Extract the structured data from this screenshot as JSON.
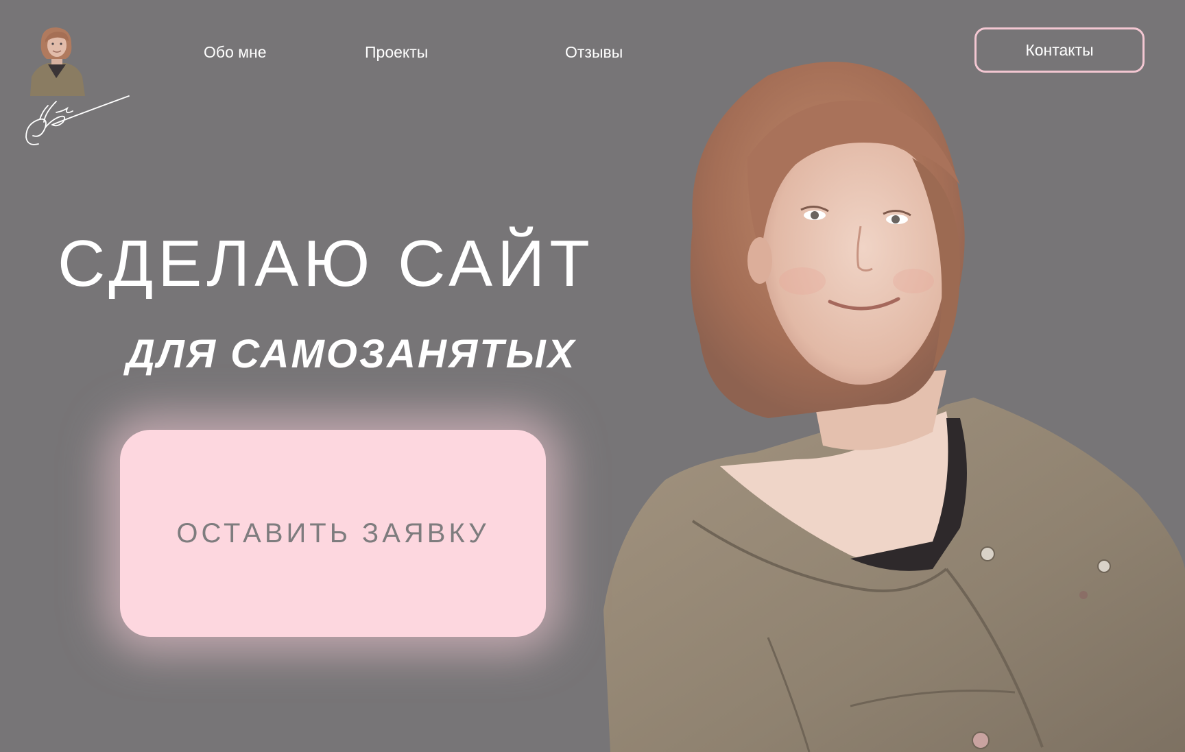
{
  "header": {
    "logo_name": "logo",
    "nav": {
      "about": "Обо мне",
      "projects": "Проекты",
      "reviews": "Отзывы"
    },
    "contacts_label": "Контакты"
  },
  "hero": {
    "title": "СДЕЛАЮ САЙТ",
    "subtitle": "ДЛЯ САМОЗАНЯТЫХ",
    "cta_label": "ОСТАВИТЬ ЗАЯВКУ"
  },
  "colors": {
    "background": "#777577",
    "accent_pink": "#fdd7df",
    "outline_pink": "#f3c7d2",
    "text_white": "#ffffff",
    "cta_text": "#7e7c7e"
  },
  "icons": {
    "logo_avatar": "avatar-photo",
    "signature": "signature-icon",
    "portrait": "portrait-photo"
  }
}
